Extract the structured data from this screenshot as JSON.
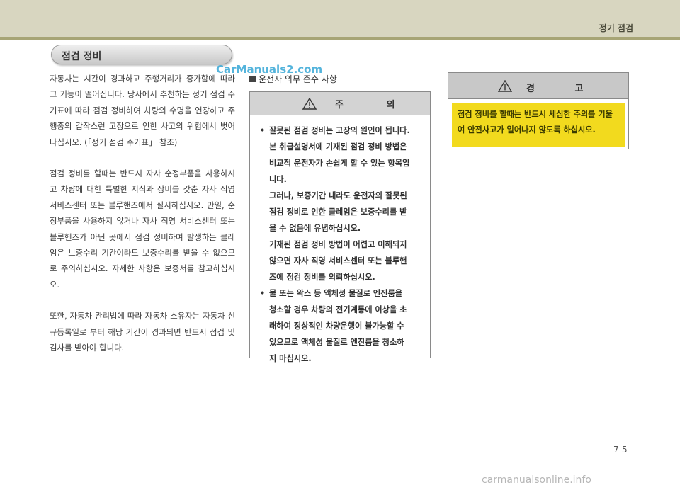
{
  "header": {
    "title": "정기 점검"
  },
  "section": {
    "title": "점검 정비"
  },
  "body": {
    "paragraphs": [
      "자동차는 시간이 경과하고 주행거리가 증가함에 따라 그 기능이 떨어집니다. 당사에서 추천하는 정기 점검 주기표에 따라 점검 정비하여 차량의 수명을 연장하고 주행중의 갑작스런 고장으로 인한 사고의 위험에서 벗어나십시오. (「정기 점검 주기표」 참조)",
      "점검 정비를 할때는 반드시 자사 순정부품을 사용하시고 차량에 대한 특별한 지식과 장비를 갖춘 자사 직영 서비스센터 또는 블루핸즈에서 실시하십시오. 만일, 순정부품을 사용하지 않거나 자사 직영 서비스센터 또는 블루핸즈가 아닌 곳에서 점검 정비하여 발생하는 클레임은 보증수리 기간이라도 보증수리를 받을 수 없으므로 주의하십시오. 자세한 사항은 보증서를 참고하십시오.",
      "또한, 자동차 관리법에 따라 자동차 소유자는 자동차 신규등록일로 부터 해당 기간이 경과되면 반드시 점검 및 검사를 받아야 합니다."
    ]
  },
  "subheading": "운전자 의무 준수 사항",
  "caution": {
    "title": "주 의",
    "items": [
      {
        "lines": [
          "잘못된 점검 정비는 고장의 원인이 됩니다.",
          "본 취급설명서에 기재된 점검 정비 방법은",
          "비교적 운전자가 손쉽게 할 수 있는 항목입",
          "니다.",
          "그러나, 보증기간 내라도 운전자의 잘못된",
          "점검 정비로 인한 클레임은 보증수리를 받",
          "을 수 없음에 유념하십시오.",
          "기재된 점검 정비 방법이 어렵고 이해되지",
          "않으면 자사 직영 서비스센터 또는 블루핸",
          "즈에 점검 정비를 의뢰하십시오."
        ]
      },
      {
        "lines": [
          "물 또는 왁스 등 액체성 물질로 엔진룸을",
          "청소할 경우 차량의 전기계통에 이상을 초",
          "래하여 정상적인 차량운행이 불가능할 수",
          "있으므로 액체성 물질로 엔진룸을 청소하",
          "지 마십시오."
        ]
      }
    ]
  },
  "warning": {
    "title": "경 고",
    "text": "점검 정비를 할때는 반드시 세심한 주의를 기울여 안전사고가 일어나지 않도록 하십시오."
  },
  "page_number": "7-5",
  "watermarks": {
    "top": "CarManuals2.com",
    "footer": "carmanualsonline.info"
  },
  "colors": {
    "band": "#d8d6c0",
    "band_line": "#a7a576",
    "warning_fill": "#f2da1e",
    "watermark_blue": "#37a7d6"
  }
}
